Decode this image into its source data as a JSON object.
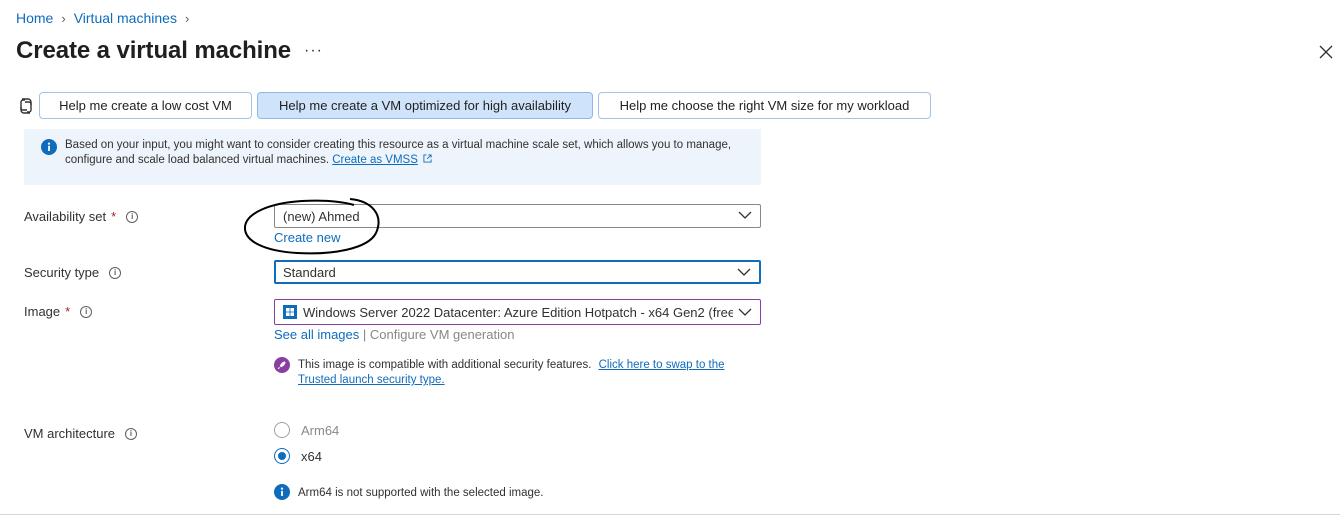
{
  "breadcrumb": {
    "home": "Home",
    "vms": "Virtual machines"
  },
  "page": {
    "title": "Create a virtual machine",
    "more": "···"
  },
  "copilot": {
    "low_cost": "Help me create a low cost VM",
    "high_availability": "Help me create a VM optimized for high availability",
    "right_size": "Help me choose the right VM size for my workload"
  },
  "banner": {
    "text": "Based on your input, you might want to consider creating this resource as a virtual machine scale set, which allows you to manage, configure and scale load balanced virtual machines.",
    "link": "Create as VMSS"
  },
  "form": {
    "availability_set": {
      "label": "Availability set",
      "value": "(new) Ahmed",
      "create_new": "Create new"
    },
    "security_type": {
      "label": "Security type",
      "value": "Standard"
    },
    "image": {
      "label": "Image",
      "value": "Windows Server 2022 Datacenter: Azure Edition Hotpatch - x64 Gen2 (free",
      "see_all": "See all images",
      "separator": "|",
      "configure": "Configure VM generation",
      "note_text": "This image is compatible with additional security features.",
      "note_link_1": "Click here to swap to the",
      "note_link_2": "Trusted launch security type."
    },
    "vm_architecture": {
      "label": "VM architecture",
      "options": [
        "Arm64",
        "x64"
      ],
      "selected": "x64",
      "note": "Arm64 is not supported with the selected image."
    }
  },
  "colors": {
    "accent": "#0f6cbd",
    "required": "#a4262c",
    "security_purple": "#8a3ea1"
  }
}
